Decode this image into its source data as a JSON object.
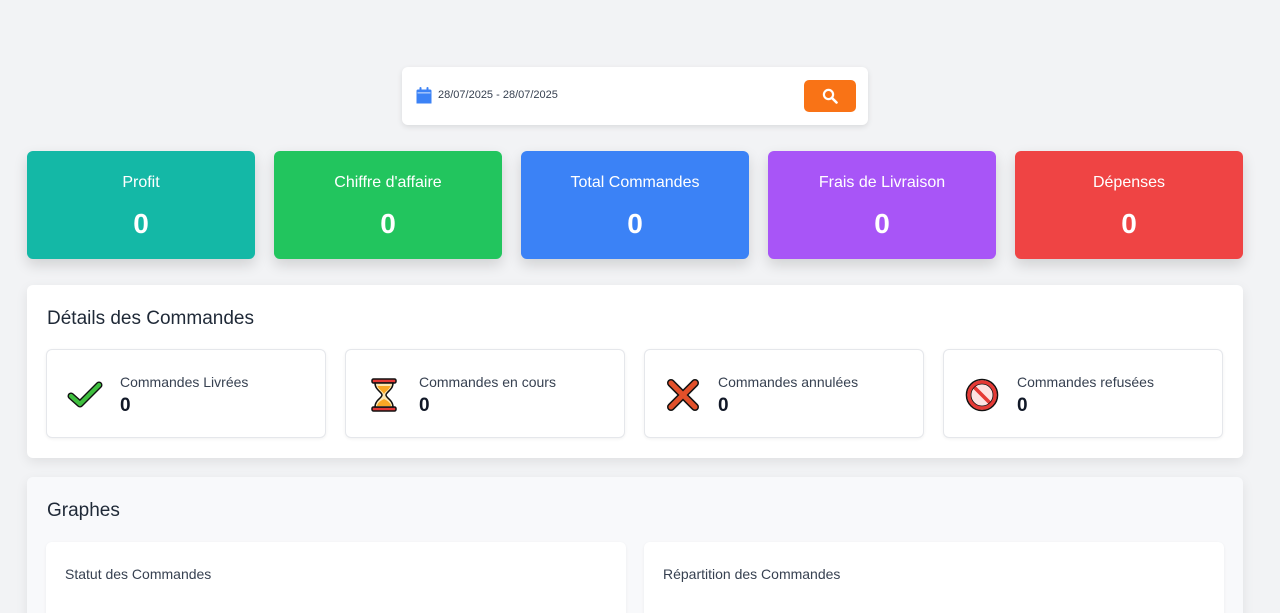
{
  "filter": {
    "date_range": "28/07/2025 - 28/07/2025",
    "calendar_icon": "calendar-icon",
    "search_icon": "search-icon",
    "button_color": "#f97316"
  },
  "stats": [
    {
      "label": "Profit",
      "value": "0",
      "color": "#14b8a6"
    },
    {
      "label": "Chiffre d'affaire",
      "value": "0",
      "color": "#22c55e"
    },
    {
      "label": "Total Commandes",
      "value": "0",
      "color": "#3b82f6"
    },
    {
      "label": "Frais de Livraison",
      "value": "0",
      "color": "#a855f7"
    },
    {
      "label": "Dépenses",
      "value": "0",
      "color": "#ef4444"
    }
  ],
  "details": {
    "title": "Détails des Commandes",
    "items": [
      {
        "label": "Commandes Livrées",
        "value": "0",
        "icon": "check-mark-icon"
      },
      {
        "label": "Commandes en cours",
        "value": "0",
        "icon": "hourglass-icon"
      },
      {
        "label": "Commandes annulées",
        "value": "0",
        "icon": "cross-mark-icon"
      },
      {
        "label": "Commandes refusées",
        "value": "0",
        "icon": "prohibited-icon"
      }
    ]
  },
  "graphs": {
    "title": "Graphes",
    "cards": [
      {
        "title": "Statut des Commandes"
      },
      {
        "title": "Répartition des Commandes"
      }
    ]
  }
}
